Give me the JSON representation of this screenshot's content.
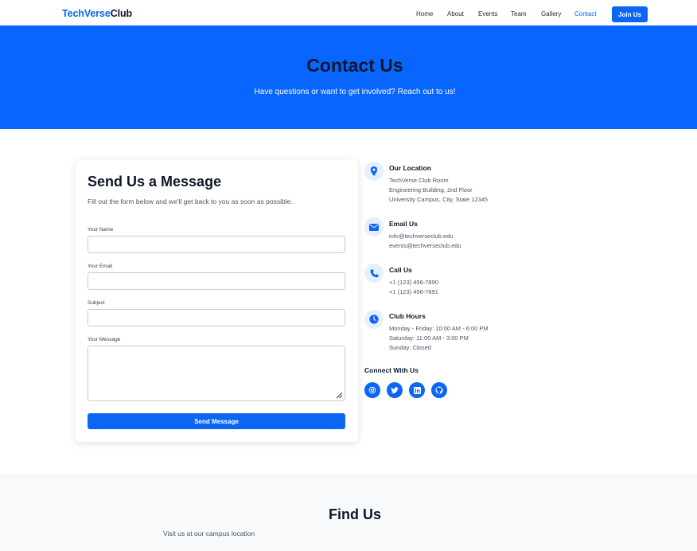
{
  "header": {
    "logo_brand": "TechVerse",
    "logo_rest": "Club",
    "nav": [
      "Home",
      "About",
      "Events",
      "Team",
      "Gallery",
      "Contact"
    ],
    "active_nav": "Contact",
    "join_label": "Join Us"
  },
  "hero": {
    "title": "Contact Us",
    "subtitle": "Have questions or want to get involved? Reach out to us!"
  },
  "form": {
    "title": "Send Us a Message",
    "description": "Fill out the form below and we'll get back to you as soon as possible.",
    "fields": [
      {
        "label": "Your Name",
        "value": ""
      },
      {
        "label": "Your Email",
        "value": ""
      },
      {
        "label": "Subject",
        "value": ""
      },
      {
        "label": "Your Message",
        "value": ""
      }
    ],
    "submit_label": "Send Message"
  },
  "info": {
    "location": {
      "title": "Our Location",
      "lines": [
        "TechVerse Club Room",
        "Engineering Building, 2nd Floor",
        "University Campus, City, State 12345"
      ],
      "icon": "map-pin-icon"
    },
    "email": {
      "title": "Email Us",
      "lines": [
        "info@techverseclub.edu",
        "events@techverseclub.edu"
      ],
      "icon": "envelope-icon"
    },
    "phone": {
      "title": "Call Us",
      "lines": [
        "+1 (123) 456-7890",
        "+1 (123) 456-7891"
      ],
      "icon": "phone-icon"
    },
    "hours": {
      "title": "Club Hours",
      "lines": [
        "Monday - Friday: 10:00 AM - 6:00 PM",
        "Saturday: 11:00 AM - 3:00 PM",
        "Sunday: Closed"
      ],
      "icon": "clock-icon"
    }
  },
  "connect": {
    "title": "Connect With Us",
    "icons": [
      "instagram-icon",
      "twitter-icon",
      "linkedin-icon",
      "github-icon"
    ]
  },
  "findus": {
    "title": "Find Us",
    "subtitle": "Visit us at our campus location"
  },
  "colors": {
    "primary": "#0b66f4",
    "hero_bg": "#0866fe",
    "text_dark": "#0f172a",
    "muted": "#4b5563"
  }
}
